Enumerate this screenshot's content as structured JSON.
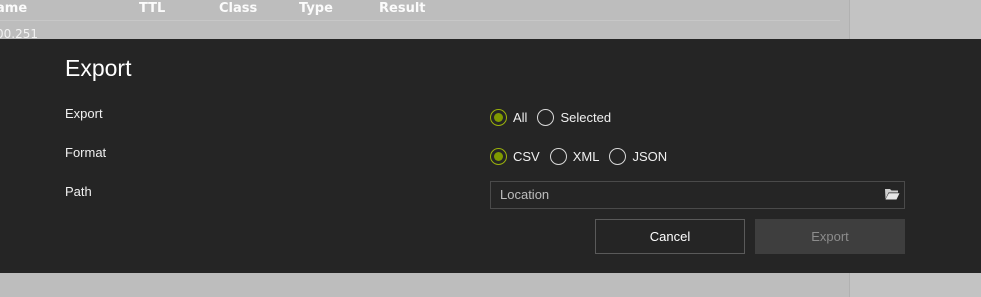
{
  "background_table": {
    "headers": [
      "ame",
      "TTL",
      "Class",
      "Type",
      "Result"
    ],
    "row_1_name": "00.251"
  },
  "dialog": {
    "title": "Export",
    "export_label": "Export",
    "format_label": "Format",
    "path_label": "Path",
    "export_options": [
      {
        "label": "All",
        "checked": true
      },
      {
        "label": "Selected",
        "checked": false
      }
    ],
    "format_options": [
      {
        "label": "CSV",
        "checked": true
      },
      {
        "label": "XML",
        "checked": false
      },
      {
        "label": "JSON",
        "checked": false
      }
    ],
    "path_placeholder": "Location",
    "folder_icon": "folder-open-icon",
    "cancel_label": "Cancel",
    "export_button_label": "Export",
    "export_button_enabled": false
  },
  "colors": {
    "dialog_bg": "#252525",
    "accent_radio": "#7f9a00",
    "backdrop": "#bdbdbd"
  }
}
